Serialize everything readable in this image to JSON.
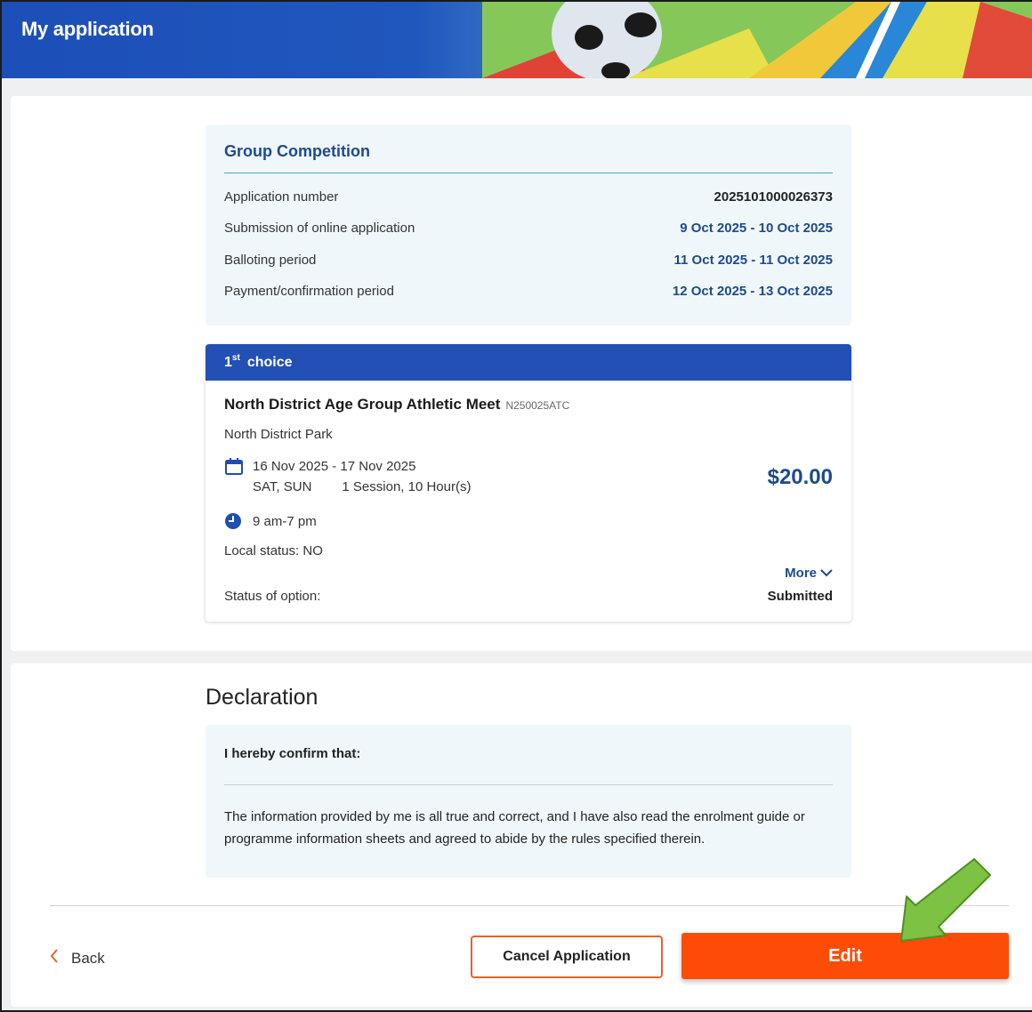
{
  "header": {
    "title": "My application"
  },
  "application": {
    "category_title": "Group Competition",
    "rows": [
      {
        "label": "Application number",
        "value": "2025101000026373"
      },
      {
        "label": "Submission of online application",
        "value": "9 Oct 2025 - 10 Oct 2025"
      },
      {
        "label": "Balloting period",
        "value": "11 Oct 2025 - 11 Oct 2025"
      },
      {
        "label": "Payment/confirmation period",
        "value": "12 Oct 2025 - 13 Oct 2025"
      }
    ]
  },
  "choice": {
    "ordinal": "1",
    "ordinal_suffix": "st",
    "heading": "choice",
    "event_name": "North District Age Group Athletic Meet",
    "event_code": "N250025ATC",
    "venue": "North District Park",
    "date_range": "16 Nov 2025 - 17 Nov 2025",
    "days": "SAT, SUN",
    "sessions": "1 Session, 10 Hour(s)",
    "time": "9 am-7 pm",
    "local_status": "Local status: NO",
    "price": "$20.00",
    "more_label": "More",
    "status_label": "Status of option:",
    "status_value": "Submitted"
  },
  "declaration": {
    "title": "Declaration",
    "heading": "I hereby confirm that:",
    "text": "The information provided by me is all true and correct, and I have also read the enrolment guide or programme information sheets and agreed to abide by the rules specified therein."
  },
  "footer": {
    "back_label": "Back",
    "cancel_label": "Cancel Application",
    "edit_label": "Edit"
  },
  "colors": {
    "brand_blue": "#2250b4",
    "accent_orange": "#fd4c07",
    "link_blue": "#1d4a8c",
    "annotation_green": "#7dc242"
  },
  "icons": [
    "calendar-icon",
    "clock-icon",
    "chevron-down-icon",
    "chevron-left-icon"
  ]
}
